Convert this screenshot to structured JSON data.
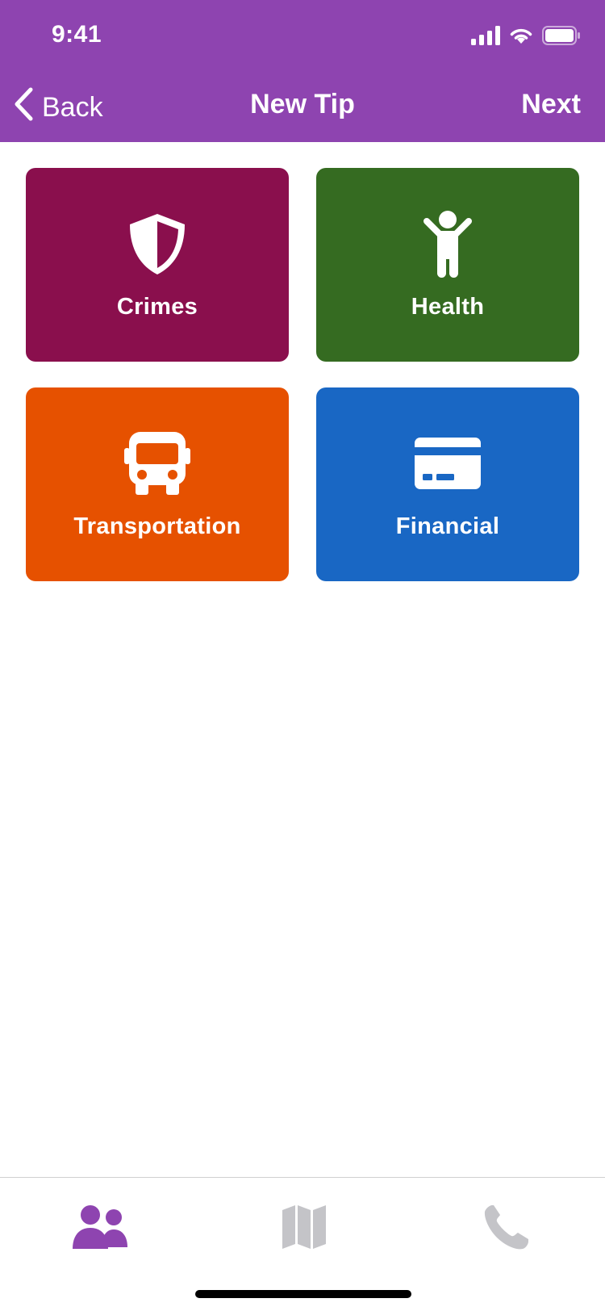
{
  "status_bar": {
    "time": "9:41"
  },
  "nav": {
    "back_label": "Back",
    "title": "New Tip",
    "next_label": "Next"
  },
  "categories": [
    {
      "label": "Crimes",
      "icon": "shield-icon",
      "color": "#8a0f4d"
    },
    {
      "label": "Health",
      "icon": "person-icon",
      "color": "#356b21"
    },
    {
      "label": "Transportation",
      "icon": "bus-icon",
      "color": "#e65100"
    },
    {
      "label": "Financial",
      "icon": "credit-card-icon",
      "color": "#1967c4"
    }
  ],
  "tab_bar": {
    "tabs": [
      {
        "icon": "people-icon",
        "active": true
      },
      {
        "icon": "map-icon",
        "active": false
      },
      {
        "icon": "phone-icon",
        "active": false
      }
    ],
    "active_color": "#8e44b0",
    "inactive_color": "#c4c4c8"
  },
  "colors": {
    "header": "#8e44b0"
  }
}
